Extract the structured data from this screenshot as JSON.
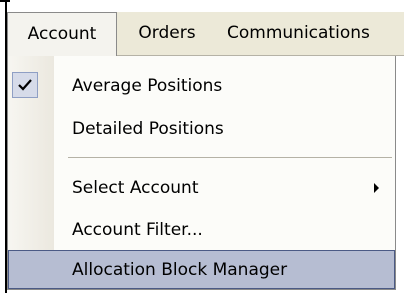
{
  "menubar": {
    "items": [
      {
        "label": "Account",
        "active": true
      },
      {
        "label": "Orders",
        "active": false
      },
      {
        "label": "Communications",
        "active": false
      }
    ]
  },
  "dropdown": {
    "items": [
      {
        "label": "Average Positions",
        "checked": true,
        "icon": "checkmark-icon"
      },
      {
        "label": "Detailed Positions",
        "checked": false
      },
      {
        "label": "Select Account",
        "submenu": true,
        "icon": "submenu-arrow-icon"
      },
      {
        "label": "Account Filter...",
        "submenu": false
      },
      {
        "label": "Allocation Block Manager",
        "highlighted": true
      }
    ]
  },
  "colors": {
    "menubar_bg": "#ece9d8",
    "menu_bg": "#fcfcf9",
    "highlight_bg": "#b6bdd2",
    "highlight_border": "#4b5a85"
  }
}
